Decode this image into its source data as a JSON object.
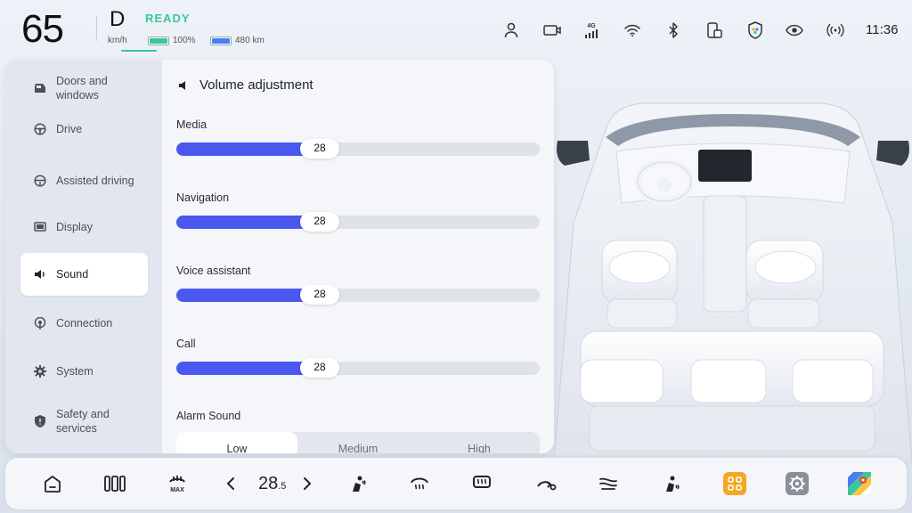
{
  "status": {
    "speed": "65",
    "gear": "D",
    "speed_unit": "km/h",
    "ready": "READY",
    "battery_percent": "100%",
    "range": "480 km",
    "time": "11:36",
    "signal_label": "4G"
  },
  "sidebar": {
    "items": [
      {
        "label": "Doors and windows",
        "icon": "car-door-icon"
      },
      {
        "label": "Drive",
        "icon": "steering-wheel-icon"
      },
      {
        "label": "Assisted driving",
        "icon": "assist-steering-icon"
      },
      {
        "label": "Display",
        "icon": "display-icon"
      },
      {
        "label": "Sound",
        "icon": "speaker-icon",
        "active": true
      },
      {
        "label": "Connection",
        "icon": "antenna-icon"
      },
      {
        "label": "System",
        "icon": "gear-icon"
      },
      {
        "label": "Safety and services",
        "icon": "shield-icon"
      }
    ]
  },
  "sound": {
    "title": "Volume adjustment",
    "sliders": [
      {
        "label": "Media",
        "value": "28",
        "fraction": 0.36
      },
      {
        "label": "Navigation",
        "value": "28",
        "fraction": 0.36
      },
      {
        "label": "Voice assistant",
        "value": "28",
        "fraction": 0.36
      },
      {
        "label": "Call",
        "value": "28",
        "fraction": 0.36
      }
    ],
    "alarm_label": "Alarm Sound",
    "alarm_options": [
      "Low",
      "Medium",
      "High"
    ],
    "alarm_selected": "Low"
  },
  "dock": {
    "temperature_main": "28",
    "temperature_decimal": ".5"
  },
  "colors": {
    "accent": "#4a58f0",
    "ready": "#38c79b",
    "apps": "#f5a623"
  }
}
